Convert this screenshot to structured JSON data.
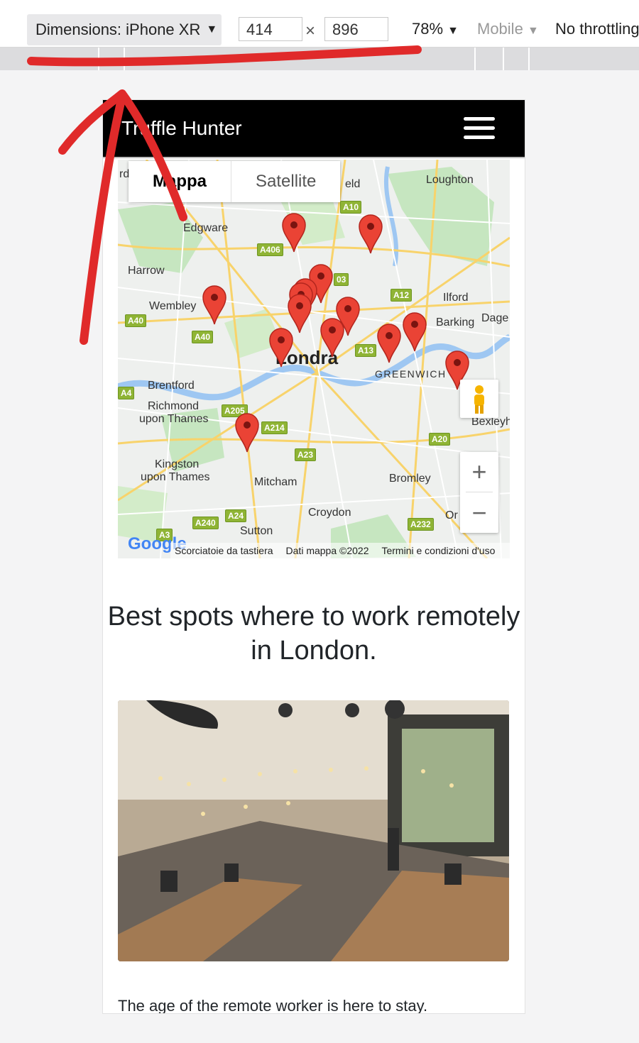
{
  "devtools": {
    "device_label": "Dimensions: iPhone XR",
    "width": "414",
    "times": "×",
    "height": "896",
    "zoom": "78%",
    "mode": "Mobile",
    "throttling": "No throttling"
  },
  "site": {
    "brand": "Truffle Hunter",
    "menu_icon": "hamburger-icon"
  },
  "map": {
    "tabs": [
      {
        "label": "Mappa",
        "active": true
      },
      {
        "label": "Satellite",
        "active": false
      }
    ],
    "places": [
      "Loughton",
      "Edgware",
      "Harrow",
      "Wembley",
      "Ilford",
      "Barking",
      "Dage",
      "Londra",
      "GREENWICH",
      "Brentford",
      "Richmond",
      "upon Thames",
      "Bexleyh",
      "Kingston",
      "upon Thames",
      "Mitcham",
      "Bromley",
      "Croydon",
      "Sutton",
      "Or",
      "rd",
      "eld"
    ],
    "roads": [
      "A10",
      "A406",
      "A12",
      "A40",
      "A40",
      "A13",
      "A4",
      "A205",
      "A214",
      "A20",
      "A23",
      "A24",
      "A240",
      "A232",
      "A3",
      "03"
    ],
    "attribution": [
      "Scorciatoie da tastiera",
      "Dati mappa ©2022",
      "Termini e condizioni d'uso"
    ],
    "google_logo": "Google",
    "zoom_in": "+",
    "zoom_out": "−",
    "marker_color": "#ea4335"
  },
  "content": {
    "headline": "Best spots where to work remotely in London.",
    "intro": "The age of the remote worker is here to stay."
  }
}
